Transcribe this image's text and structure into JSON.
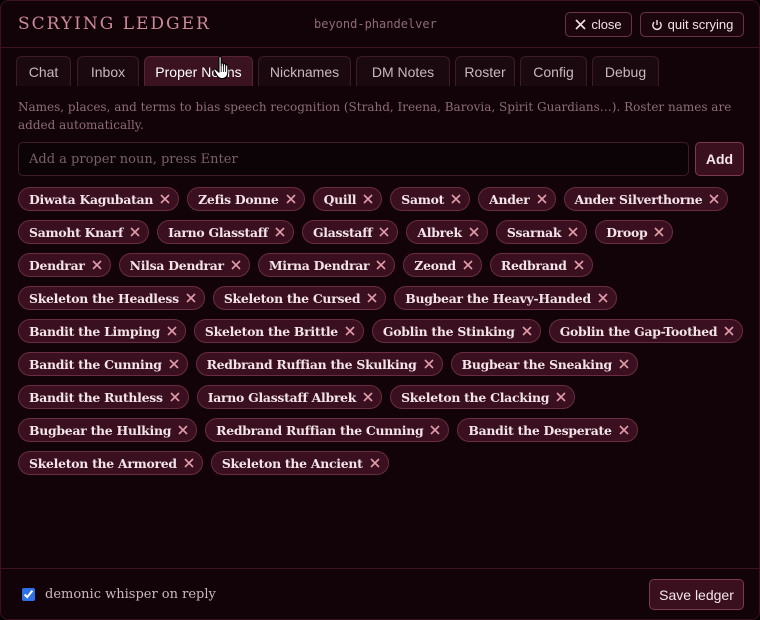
{
  "header": {
    "title": "SCRYING LEDGER",
    "campaign": "beyond-phandelver",
    "close_label": "close",
    "quit_label": "quit scrying"
  },
  "tabs": [
    {
      "label": "Chat",
      "active": false
    },
    {
      "label": "Inbox",
      "active": false
    },
    {
      "label": "Proper Nouns",
      "active": true
    },
    {
      "label": "Nicknames",
      "active": false
    },
    {
      "label": "DM Notes",
      "active": false
    },
    {
      "label": "Roster",
      "active": false
    },
    {
      "label": "Config",
      "active": false
    },
    {
      "label": "Debug",
      "active": false
    }
  ],
  "proper_nouns": {
    "helper_text": "Names, places, and terms to bias speech recognition (Strahd, Ireena, Barovia, Spirit Guardians…). Roster names are added automatically.",
    "input_placeholder": "Add a proper noun, press Enter",
    "input_value": "",
    "add_label": "Add",
    "terms": [
      "Diwata Kagubatan",
      "Zefis Donne",
      "Quill",
      "Samot",
      "Ander",
      "Ander Silverthorne",
      "Samoht Knarf",
      "Iarno Glasstaff",
      "Glasstaff",
      "Albrek",
      "Ssarnak",
      "Droop",
      "Dendrar",
      "Nilsa Dendrar",
      "Mirna Dendrar",
      "Zeond",
      "Redbrand",
      "Skeleton the Headless",
      "Skeleton the Cursed",
      "Bugbear the Heavy-Handed",
      "Bandit the Limping",
      "Skeleton the Brittle",
      "Goblin the Stinking",
      "Goblin the Gap-Toothed",
      "Bandit the Cunning",
      "Redbrand Ruffian the Skulking",
      "Bugbear the Sneaking",
      "Bandit the Ruthless",
      "Iarno Glasstaff Albrek",
      "Skeleton the Clacking",
      "Bugbear the Hulking",
      "Redbrand Ruffian the Cunning",
      "Bandit the Desperate",
      "Skeleton the Armored",
      "Skeleton the Ancient"
    ]
  },
  "footer": {
    "checkbox_label": "demonic whisper on reply",
    "checkbox_checked": true,
    "save_label": "Save ledger"
  },
  "colors": {
    "background": "#120309",
    "accent": "#cf8a9c",
    "chip_bg": "#3a1020",
    "chip_border": "#6a2c40",
    "remove_x": "#e09aa8"
  },
  "icons": {
    "close": "x-icon",
    "quit": "power-icon",
    "chip_remove": "x-icon",
    "pointer": "hand-cursor-icon"
  }
}
